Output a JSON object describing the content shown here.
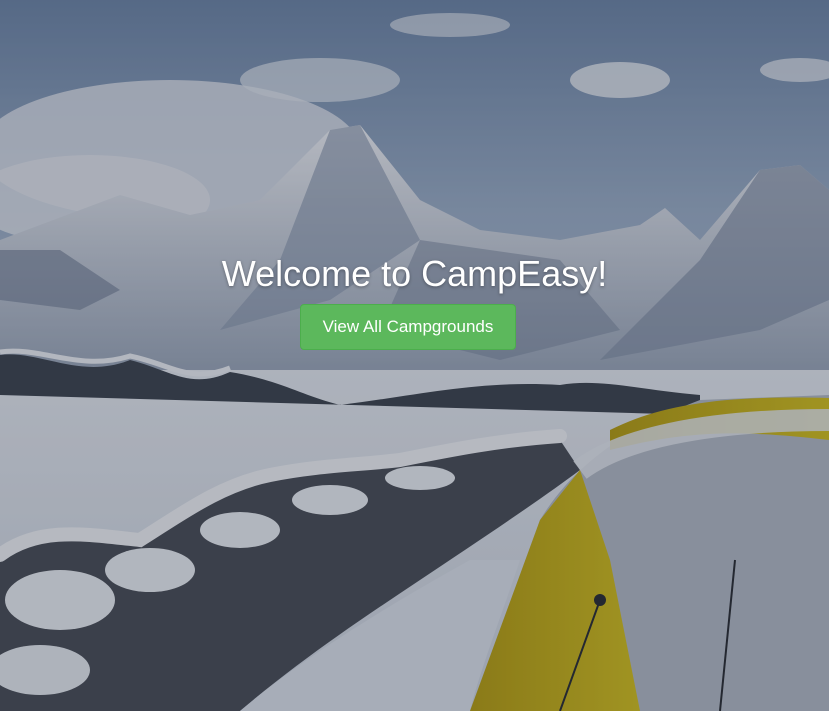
{
  "hero": {
    "heading": "Welcome to CampEasy!",
    "button_label": "View All Campgrounds",
    "background": "snowy-mountain-campsite-photo"
  },
  "colors": {
    "button_bg": "#5cb85c",
    "button_text": "#ffffff",
    "heading_text": "#ffffff",
    "tent_yellow": "#c9b416"
  }
}
